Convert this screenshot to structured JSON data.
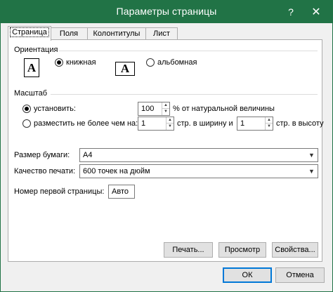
{
  "window": {
    "title": "Параметры страницы",
    "help_glyph": "?",
    "close_glyph": "✕"
  },
  "tabs": [
    {
      "label": "Страница",
      "active": true
    },
    {
      "label": "Поля"
    },
    {
      "label": "Колонтитулы"
    },
    {
      "label": "Лист"
    }
  ],
  "orientation": {
    "group_label": "Ориентация",
    "icon_letter": "A",
    "portrait_label": "книжная",
    "landscape_label": "альбомная",
    "selected": "portrait"
  },
  "scaling": {
    "group_label": "Масштаб",
    "adjust_label": "установить:",
    "adjust_value": "100",
    "adjust_suffix": "% от натуральной величины",
    "fit_label": "разместить не более чем на:",
    "fit_wide_value": "1",
    "fit_wide_suffix": "стр. в ширину и",
    "fit_tall_value": "1",
    "fit_tall_suffix": "стр. в высоту",
    "selected": "adjust"
  },
  "paper": {
    "size_label": "Размер бумаги:",
    "size_value": "A4",
    "quality_label": "Качество печати:",
    "quality_value": "600 точек на дюйм"
  },
  "first_page": {
    "label": "Номер первой страницы:",
    "value": "Авто"
  },
  "buttons": {
    "print": "Печать...",
    "preview": "Просмотр",
    "options": "Свойства...",
    "ok": "ОК",
    "cancel": "Отмена"
  },
  "colors": {
    "titlebar": "#217346",
    "default_button_border": "#0078d7"
  }
}
